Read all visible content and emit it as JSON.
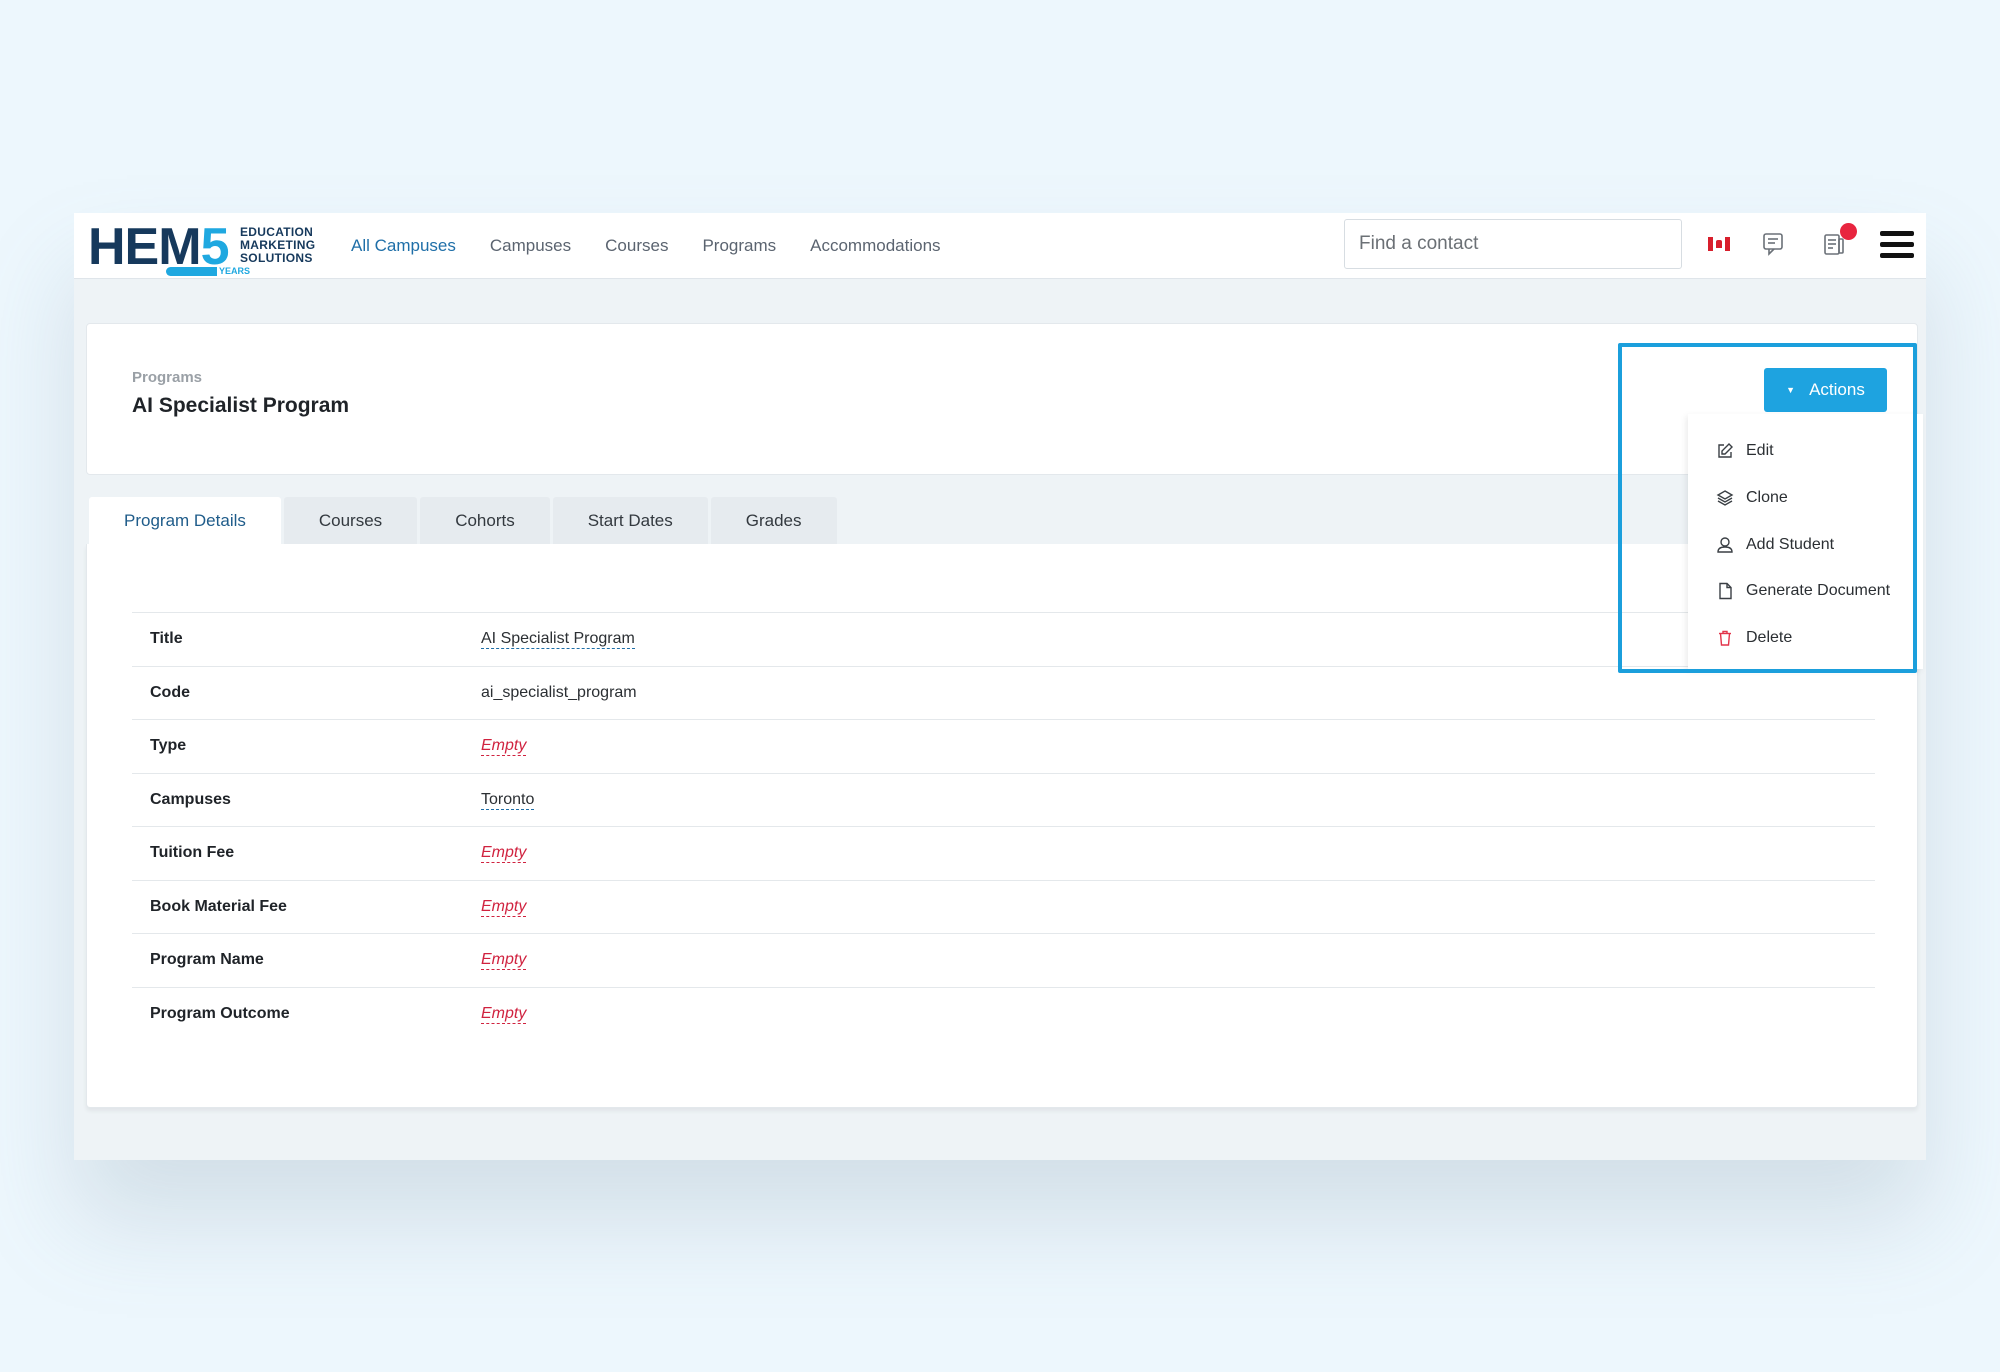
{
  "logo": {
    "mark": "HEM",
    "number": "5",
    "words": [
      "EDUCATION",
      "MARKETING",
      "SOLUTIONS"
    ],
    "tag": "YEARS"
  },
  "nav": {
    "items": [
      "All Campuses",
      "Campuses",
      "Courses",
      "Programs",
      "Accommodations"
    ],
    "active_index": 0
  },
  "search": {
    "placeholder": "Find a contact"
  },
  "header": {
    "breadcrumb": "Programs",
    "title": "AI Specialist Program",
    "actions_label": "Actions"
  },
  "tabs": [
    "Program Details",
    "Courses",
    "Cohorts",
    "Start Dates",
    "Grades"
  ],
  "details": [
    {
      "label": "Title",
      "value": "AI Specialist Program",
      "empty": false
    },
    {
      "label": "Code",
      "value": "ai_specialist_program",
      "empty": false
    },
    {
      "label": "Type",
      "value": "Empty",
      "empty": true
    },
    {
      "label": "Campuses",
      "value": "Toronto",
      "empty": false
    },
    {
      "label": "Tuition Fee",
      "value": "Empty",
      "empty": true
    },
    {
      "label": "Book Material Fee",
      "value": "Empty",
      "empty": true
    },
    {
      "label": "Program Name",
      "value": "Empty",
      "empty": true
    },
    {
      "label": "Program Outcome",
      "value": "Empty",
      "empty": true
    }
  ],
  "actions_menu": [
    {
      "label": "Edit",
      "icon": "edit-icon"
    },
    {
      "label": "Clone",
      "icon": "layers-icon"
    },
    {
      "label": "Add Student",
      "icon": "user-icon"
    },
    {
      "label": "Generate Document",
      "icon": "document-icon"
    },
    {
      "label": "Delete",
      "icon": "trash-icon"
    }
  ],
  "colors": {
    "accent": "#1ea3e0",
    "nav_active": "#1f6fa8",
    "empty": "#d0223f",
    "notification": "#e8253f",
    "highlight": "#1b9fdc"
  }
}
